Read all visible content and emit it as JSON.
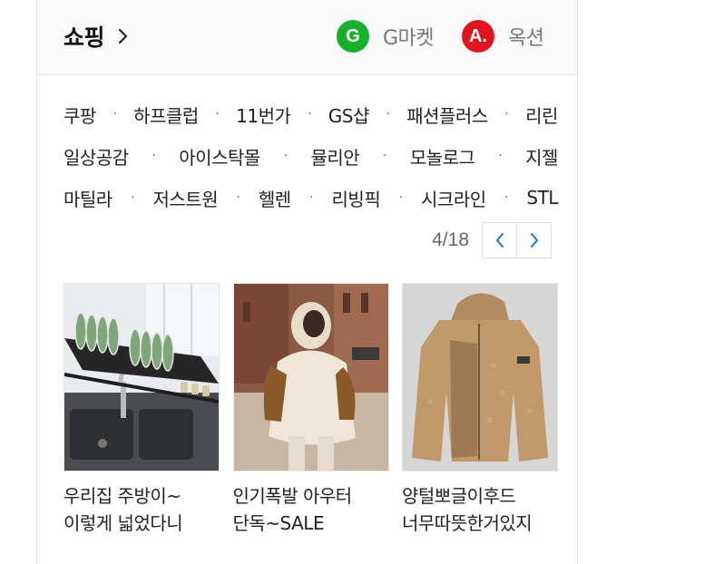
{
  "header": {
    "title": "쇼핑",
    "partners": [
      {
        "logo_letter": "G",
        "label": "G마켓",
        "color": "#16b02a"
      },
      {
        "logo_letter": "A.",
        "label": "옥션",
        "color": "#e0141e"
      }
    ]
  },
  "shop_links": {
    "rows": [
      [
        "쿠팡",
        "하프클럽",
        "11번가",
        "GS샵",
        "패션플러스",
        "리린"
      ],
      [
        "일상공감",
        "아이스탁몰",
        "뮬리안",
        "모놀로그",
        "지젤"
      ],
      [
        "마틸라",
        "저스트원",
        "헬렌",
        "리빙픽",
        "시크라인",
        "STL"
      ]
    ],
    "separator": "·"
  },
  "pager": {
    "current": "4",
    "total": "18",
    "display": "4/18",
    "prev_icon": "chevron-left-icon",
    "next_icon": "chevron-right-icon",
    "accent": "#1a73e8"
  },
  "products": [
    {
      "line1": "우리집 주방이~",
      "line2": "이렇게 넓었다니",
      "image": "kitchen dish rack"
    },
    {
      "line1": "인기폭발 아우터",
      "line2": "단독~SALE",
      "image": "woman in fleece coat"
    },
    {
      "line1": "양털뽀글이후드",
      "line2": "너무따뜻한거있지",
      "image": "fleece hooded jacket"
    }
  ]
}
